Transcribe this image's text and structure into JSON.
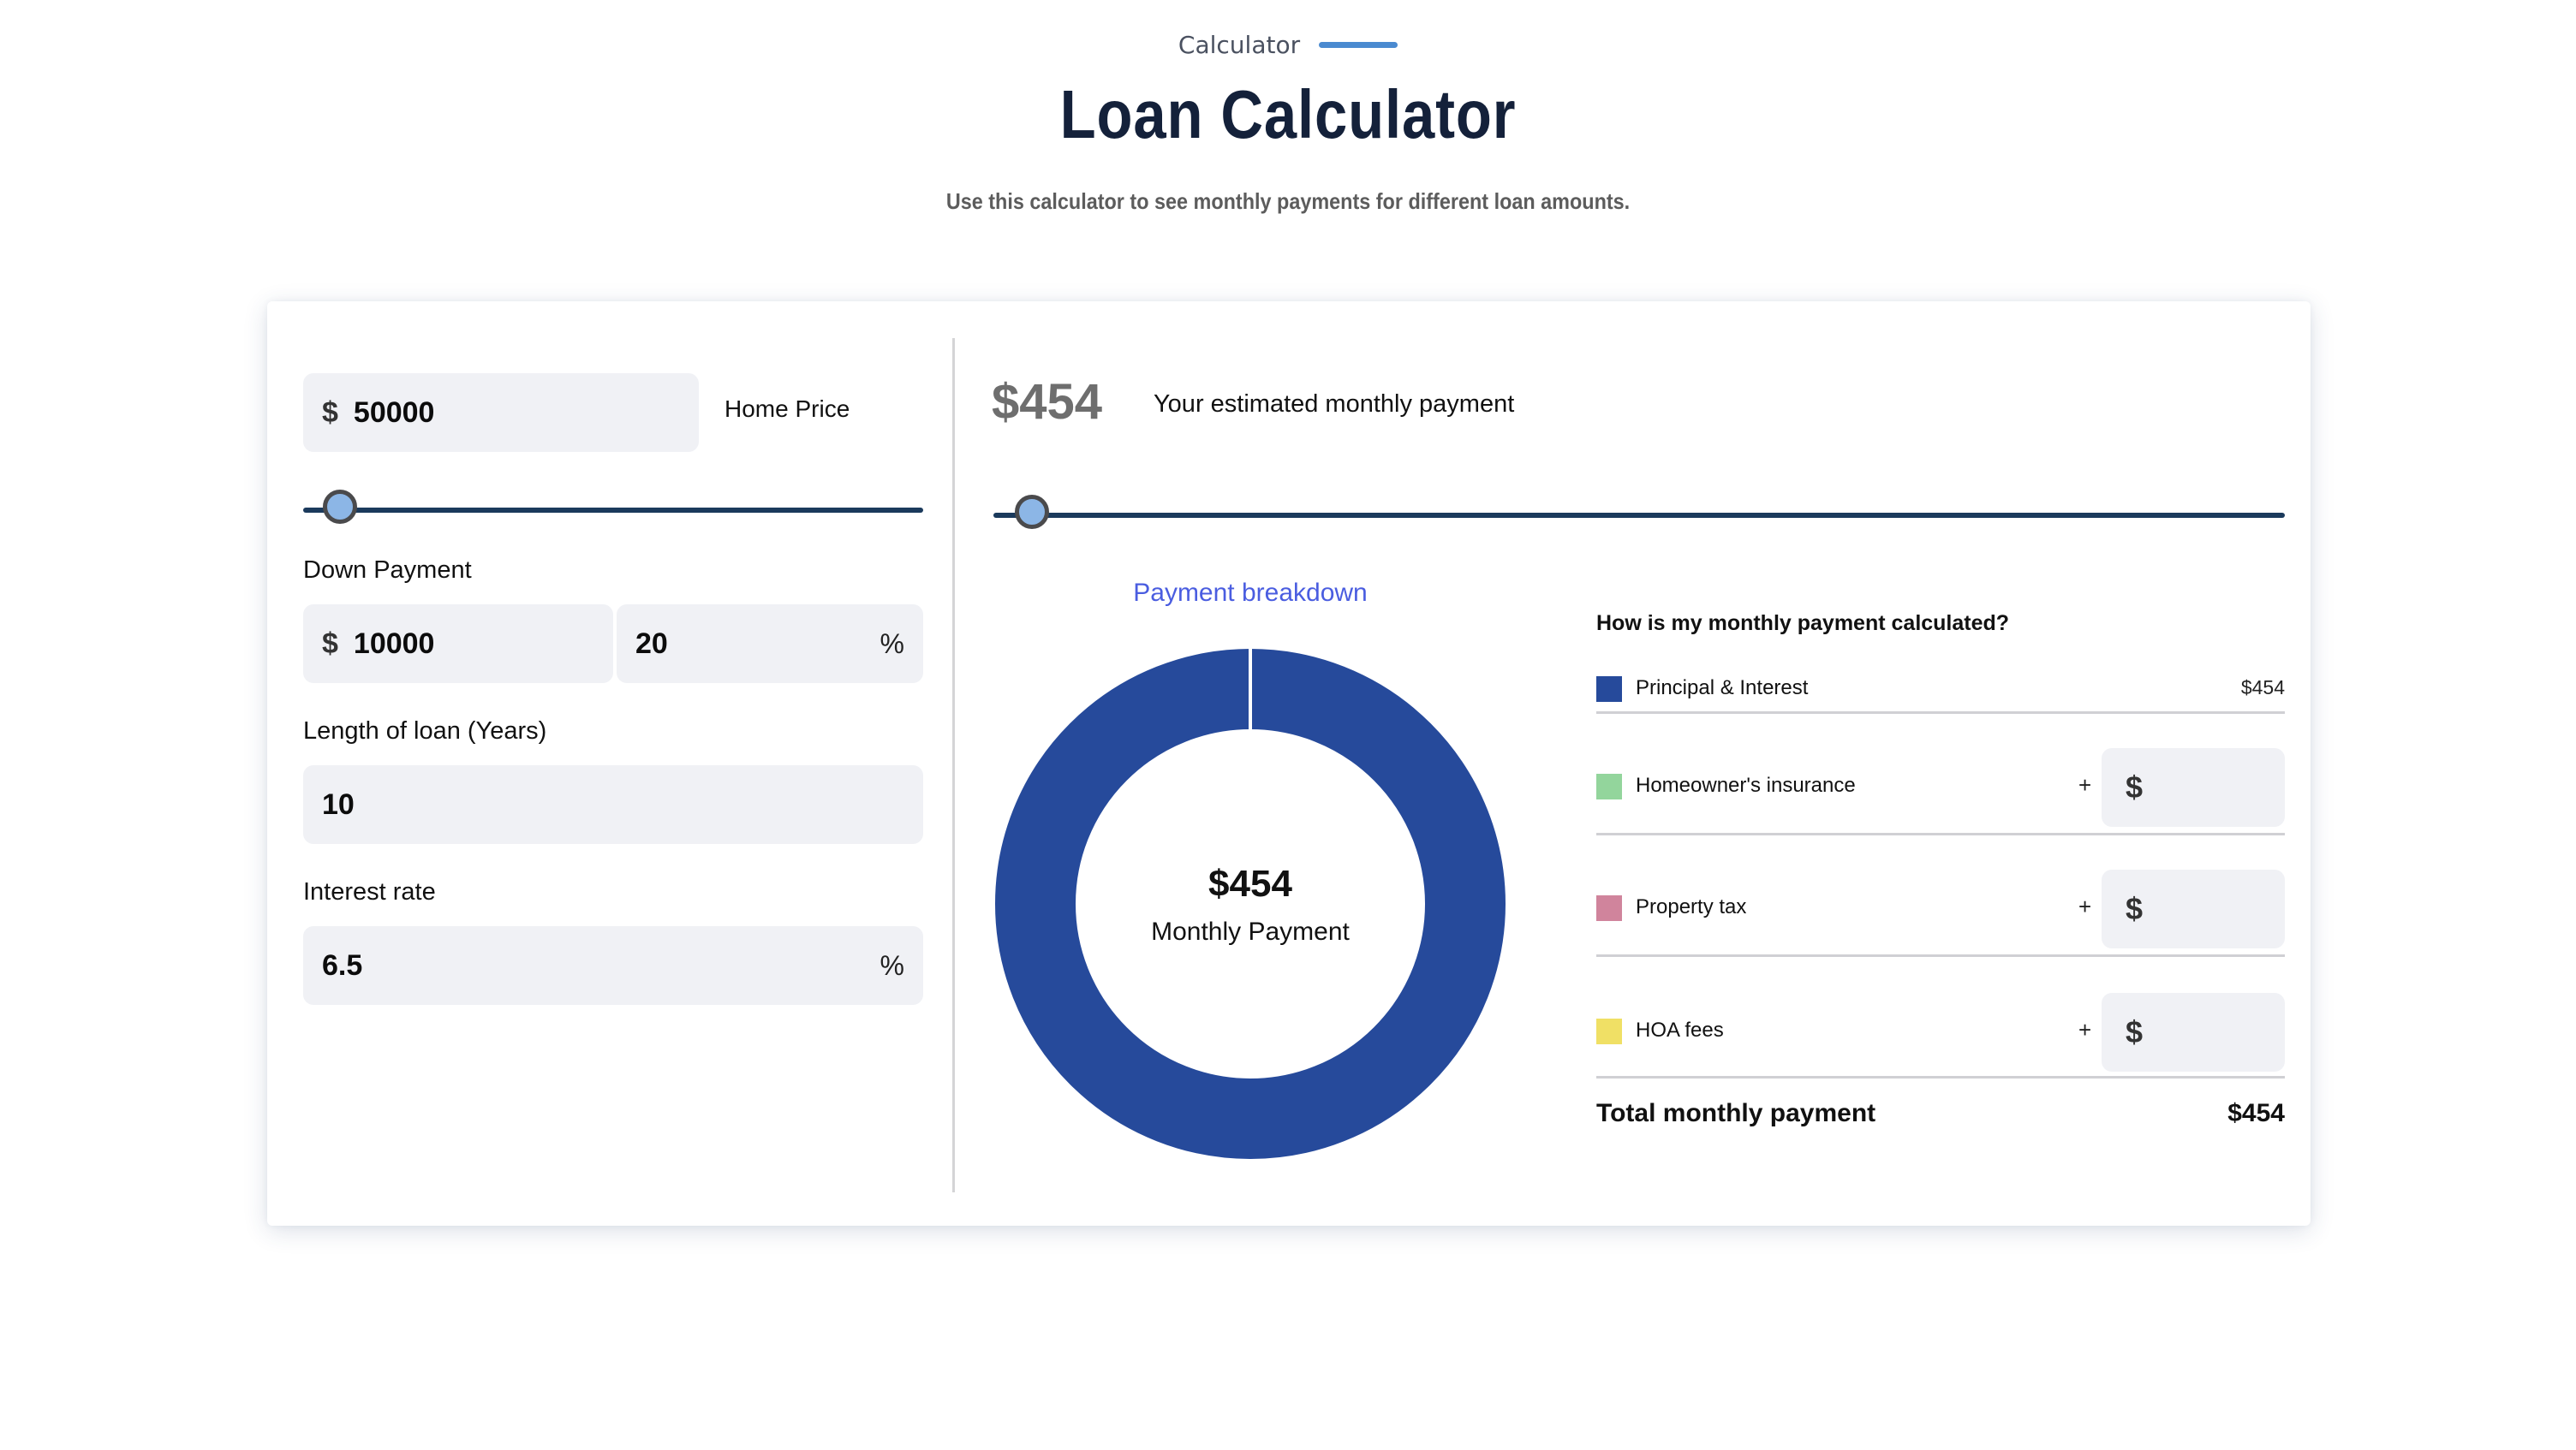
{
  "header": {
    "eyebrow": "Calculator",
    "title": "Loan Calculator",
    "subtitle": "Use this calculator to see monthly payments for different loan amounts."
  },
  "inputs": {
    "home_price": {
      "currency": "$",
      "value": "50000",
      "label": "Home Price",
      "slider_fraction": 0.06
    },
    "down_payment": {
      "label": "Down Payment",
      "currency": "$",
      "amount": "10000",
      "percent": "20",
      "percent_symbol": "%"
    },
    "loan_length": {
      "label": "Length of loan (Years)",
      "value": "10"
    },
    "interest_rate": {
      "label": "Interest rate",
      "value": "6.5",
      "percent_symbol": "%"
    }
  },
  "result": {
    "monthly_amount": "$454",
    "monthly_label": "Your estimated monthly payment",
    "slider_fraction": 0.03,
    "breakdown_title": "Payment breakdown",
    "donut_center_amount": "$454",
    "donut_center_label": "Monthly Payment"
  },
  "chart_data": {
    "type": "pie",
    "title": "Payment breakdown",
    "donut": true,
    "categories": [
      "Principal & Interest",
      "Homeowner's insurance",
      "Property tax",
      "HOA fees"
    ],
    "values": [
      454,
      0,
      0,
      0
    ],
    "colors": [
      "#264a9b",
      "#93d59c",
      "#d0849c",
      "#f0e065"
    ],
    "center_text": [
      "$454",
      "Monthly Payment"
    ]
  },
  "breakdown": {
    "title": "How is my monthly payment calculated?",
    "rows": [
      {
        "label": "Principal & Interest",
        "color": "#264a9b",
        "value": "$454"
      },
      {
        "label": "Homeowner's insurance",
        "color": "#93d59c",
        "plus": "+",
        "currency": "$",
        "value": ""
      },
      {
        "label": "Property tax",
        "color": "#d0849c",
        "plus": "+",
        "currency": "$",
        "value": ""
      },
      {
        "label": "HOA fees",
        "color": "#f0e065",
        "plus": "+",
        "currency": "$",
        "value": ""
      }
    ],
    "total_label": "Total monthly payment",
    "total_value": "$454"
  },
  "colors": {
    "accent": "#4a8ad0",
    "title": "#14213a",
    "slider_track": "#1b3a5c",
    "slider_thumb": "#8cb6e6",
    "field_bg": "#f0f1f5",
    "breakdown_title": "#4a5de0"
  }
}
